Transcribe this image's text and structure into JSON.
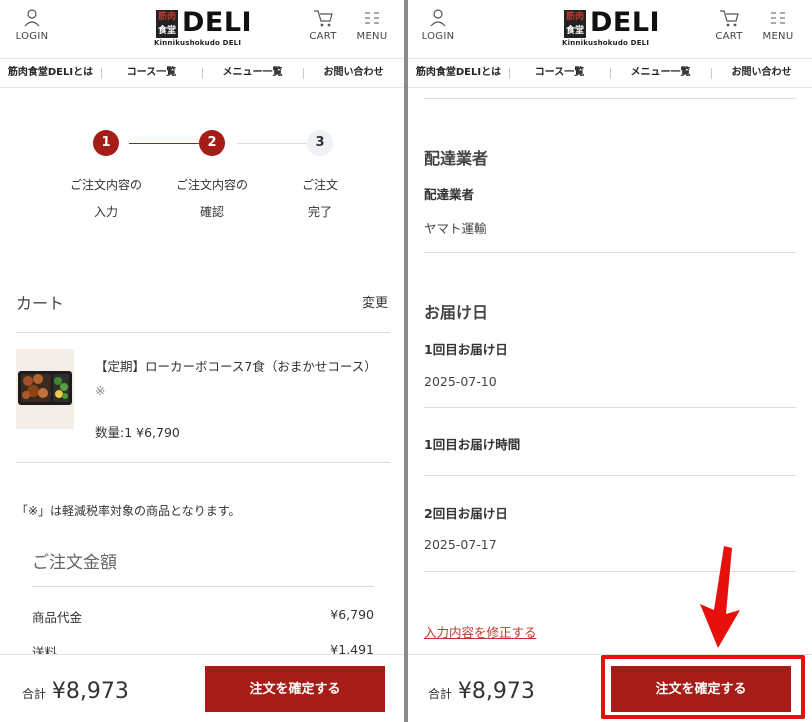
{
  "header": {
    "login_label": "LOGIN",
    "cart_label": "CART",
    "menu_label": "MENU",
    "logo_mark_top": "筋肉",
    "logo_mark_bottom": "食堂",
    "logo_text": "DELI",
    "logo_sub": "Kinnikushokudo DELI"
  },
  "nav": {
    "items": [
      "筋肉食堂DELIとは",
      "コース一覧",
      "メニュー一覧",
      "お問い合わせ"
    ]
  },
  "steps": [
    {
      "number": "1",
      "label_line1": "ご注文内容の",
      "label_line2": "入力",
      "state": "done"
    },
    {
      "number": "2",
      "label_line1": "ご注文内容の",
      "label_line2": "確認",
      "state": "current"
    },
    {
      "number": "3",
      "label_line1": "ご注文",
      "label_line2": "完了",
      "state": "pending"
    }
  ],
  "cart": {
    "title": "カート",
    "change_label": "変更",
    "product_name": "【定期】ローカーボコース7食（おまかせコース）",
    "product_mark": "※",
    "product_qty": "数量:1 ¥6,790",
    "note": "「※」は軽減税率対象の商品となります。"
  },
  "summary": {
    "title": "ご注文金額",
    "rows": [
      {
        "label": "商品代金",
        "value": "¥6,790"
      },
      {
        "label": "送料",
        "value": "¥1,491"
      }
    ]
  },
  "footer": {
    "total_label": "合計",
    "total_value": "¥8,973",
    "confirm_label": "注文を確定する"
  },
  "right": {
    "carrier_heading": "配達業者",
    "carrier_label": "配達業者",
    "carrier_value": "ヤマト運輸",
    "delivery_heading": "お届け日",
    "first_date_label": "1回目お届け日",
    "first_date_value": "2025-07-10",
    "first_time_label": "1回目お届け時間",
    "second_date_label": "2回目お届け日",
    "second_date_value": "2025-07-17",
    "edit_link": "入力内容を修正する"
  },
  "colors": {
    "accent": "#a51d16",
    "highlight": "#e8100c"
  }
}
